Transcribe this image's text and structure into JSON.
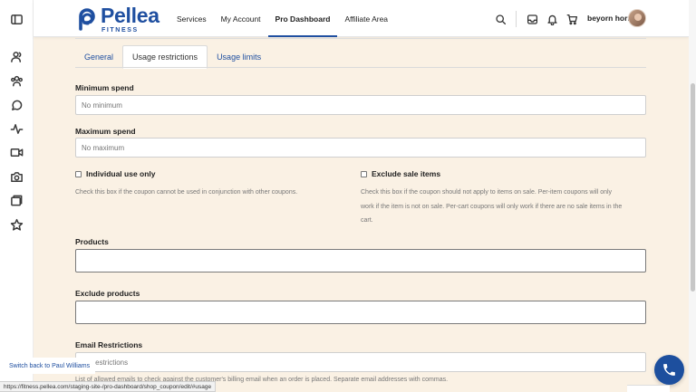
{
  "brand": {
    "name": "Pellea",
    "sub": "FITNESS",
    "color": "#1f4fa0"
  },
  "nav": [
    {
      "label": "Services",
      "active": false
    },
    {
      "label": "My Account",
      "active": false
    },
    {
      "label": "Pro Dashboard",
      "active": true
    },
    {
      "label": "Affiliate Area",
      "active": false
    }
  ],
  "header_icons": [
    "search-icon",
    "inbox-icon",
    "bell-icon",
    "cart-icon"
  ],
  "user": {
    "name": "beyorn horn"
  },
  "sidebar_icons": [
    "sidebar-toggle-icon",
    "users-icon",
    "group-icon",
    "chat-icon",
    "activity-icon",
    "video-icon",
    "camera-icon",
    "folders-icon",
    "star-icon"
  ],
  "tabs": [
    {
      "label": "General",
      "active": false
    },
    {
      "label": "Usage restrictions",
      "active": true
    },
    {
      "label": "Usage limits",
      "active": false
    }
  ],
  "form": {
    "minimum_spend": {
      "label": "Minimum spend",
      "value": "",
      "placeholder": "No minimum"
    },
    "maximum_spend": {
      "label": "Maximum spend",
      "value": "",
      "placeholder": "No maximum"
    },
    "individual_use": {
      "label": "Individual use only",
      "checked": false,
      "help": "Check this box if the coupon cannot be used in conjunction with other coupons."
    },
    "exclude_sale": {
      "label": "Exclude sale items",
      "checked": false,
      "help_1": "Check this box if the coupon should not apply to items on sale. Per-item coupons will only",
      "help_2": "work if the item is not on sale. Per-cart coupons will only work if there are no sale items in the",
      "help_3": "cart."
    },
    "products": {
      "label": "Products",
      "value": ""
    },
    "exclude_products": {
      "label": "Exclude products",
      "value": ""
    },
    "email_restrictions": {
      "label": "Email Restrictions",
      "placeholder": "No restrictions",
      "help": "List of allowed emails to check against the customer's billing email when an order is placed. Separate email addresses with commas."
    }
  },
  "switch_back": "Switch back to Paul Williams",
  "status_url": "https://fitness.pellea.com/staging-site-/pro-dashboard/shop_coupon/edit/#usage",
  "colors": {
    "accent": "#1f4fa0",
    "page_bg": "#faf1e4",
    "call_button": "#1d4f9e"
  }
}
